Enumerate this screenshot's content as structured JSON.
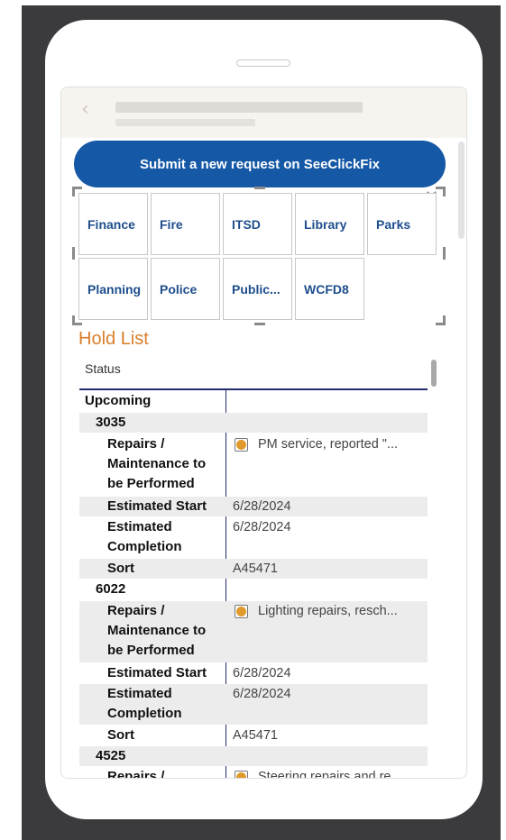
{
  "submit": {
    "label": "Submit a new request on SeeClickFix"
  },
  "departments": [
    "Finance",
    "Fire",
    "ITSD",
    "Library",
    "Parks",
    "Planning",
    "Police",
    "Public...",
    "WCFD8"
  ],
  "hold_list": {
    "title": "Hold List",
    "column_header": "Status",
    "group": "Upcoming",
    "units": [
      {
        "id": "3035",
        "repairs_label": "Repairs / Maintenance to be Performed",
        "repairs_value": "PM service, reported \"...",
        "est_start_label": "Estimated Start",
        "est_start_value": "6/28/2024",
        "est_completion_label": "Estimated Completion",
        "est_completion_value": "6/28/2024",
        "sort_label": "Sort",
        "sort_value": "A45471"
      },
      {
        "id": "6022",
        "repairs_label": "Repairs / Maintenance to be Performed",
        "repairs_value": "Lighting repairs, resch...",
        "est_start_label": "Estimated Start",
        "est_start_value": "6/28/2024",
        "est_completion_label": "Estimated Completion",
        "est_completion_value": "6/28/2024",
        "sort_label": "Sort",
        "sort_value": "A45471"
      },
      {
        "id": "4525",
        "repairs_label": "Repairs /",
        "repairs_value": "Steering repairs and re..."
      }
    ]
  },
  "colors": {
    "accent_button": "#1558a6",
    "title_orange": "#d97d2a",
    "tile_text": "#1e4e8c",
    "status_dot": "#e09a2c"
  }
}
